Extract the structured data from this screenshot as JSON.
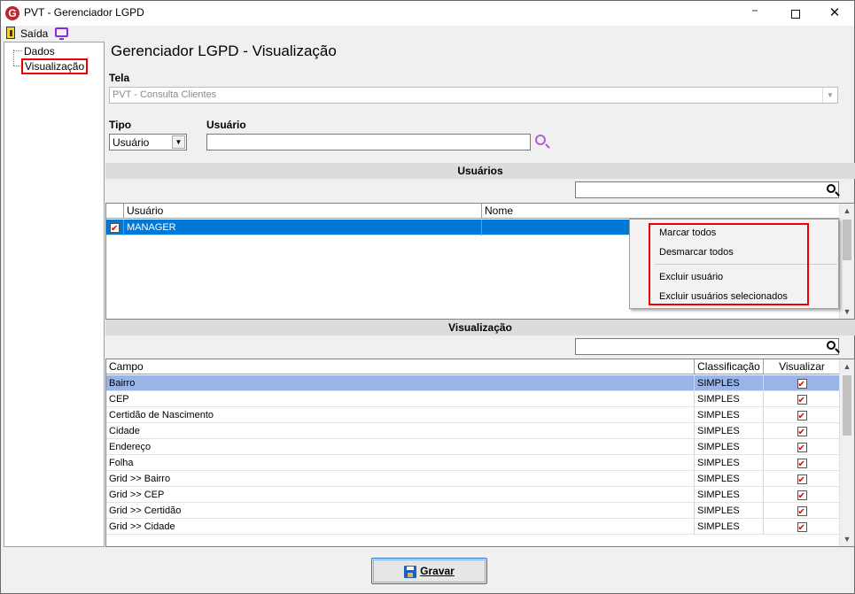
{
  "window": {
    "title": "PVT - Gerenciador LGPD",
    "app_icon": "G"
  },
  "toolbar": {
    "exit_label": "Saída"
  },
  "tree": {
    "items": [
      {
        "label": "Dados"
      },
      {
        "label": "Visualização"
      }
    ]
  },
  "main": {
    "title": "Gerenciador LGPD - Visualização",
    "tela_label": "Tela",
    "tela_value": "PVT - Consulta Clientes",
    "tipo_label": "Tipo",
    "tipo_value": "Usuário",
    "usuario_label": "Usuário",
    "usuario_value": ""
  },
  "users_section": {
    "title": "Usuários",
    "columns": [
      "Usuário",
      "Nome"
    ],
    "rows": [
      {
        "usuario": "MANAGER",
        "nome": "",
        "checked": true
      }
    ]
  },
  "context_menu": {
    "items": [
      "Marcar todos",
      "Desmarcar todos",
      "Excluir usuário",
      "Excluir usuários selecionados"
    ]
  },
  "view_section": {
    "title": "Visualização",
    "columns": [
      "Campo",
      "Classificação",
      "Visualizar"
    ],
    "rows": [
      {
        "campo": "Bairro",
        "classificacao": "SIMPLES",
        "visualizar": true
      },
      {
        "campo": "CEP",
        "classificacao": "SIMPLES",
        "visualizar": true
      },
      {
        "campo": "Certidão de Nascimento",
        "classificacao": "SIMPLES",
        "visualizar": true
      },
      {
        "campo": "Cidade",
        "classificacao": "SIMPLES",
        "visualizar": true
      },
      {
        "campo": "Endereço",
        "classificacao": "SIMPLES",
        "visualizar": true
      },
      {
        "campo": "Folha",
        "classificacao": "SIMPLES",
        "visualizar": true
      },
      {
        "campo": "Grid >> Bairro",
        "classificacao": "SIMPLES",
        "visualizar": true
      },
      {
        "campo": "Grid >> CEP",
        "classificacao": "SIMPLES",
        "visualizar": true
      },
      {
        "campo": "Grid >> Certidão",
        "classificacao": "SIMPLES",
        "visualizar": true
      },
      {
        "campo": "Grid >> Cidade",
        "classificacao": "SIMPLES",
        "visualizar": true
      }
    ]
  },
  "footer": {
    "save_label": "Gravar"
  },
  "colors": {
    "selection": "#0078d7",
    "row_highlight": "#99b4e6",
    "highlight_border": "#e00000"
  }
}
